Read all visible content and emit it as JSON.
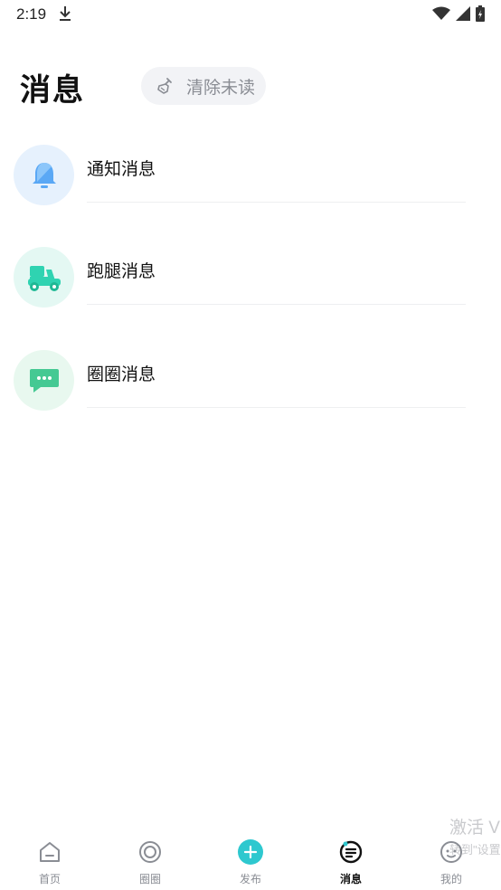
{
  "status_bar": {
    "time": "2:19"
  },
  "header": {
    "title": "消息",
    "clear_button": "清除未读"
  },
  "messages": [
    {
      "name": "通知消息",
      "icon": "bell-icon",
      "color": "#5aa8f5",
      "bg": "#e6f1fd"
    },
    {
      "name": "跑腿消息",
      "icon": "scooter-icon",
      "color": "#2fd3b1",
      "bg": "#e4f8f3"
    },
    {
      "name": "圈圈消息",
      "icon": "chat-bubble-icon",
      "color": "#45c993",
      "bg": "#e8f8ef"
    }
  ],
  "tabs": [
    {
      "label": "首页",
      "icon": "home-icon"
    },
    {
      "label": "圈圈",
      "icon": "circle-icon"
    },
    {
      "label": "发布",
      "icon": "plus-icon"
    },
    {
      "label": "消息",
      "icon": "message-icon",
      "active": true
    },
    {
      "label": "我的",
      "icon": "profile-icon"
    }
  ],
  "watermark": {
    "line1": "激活 V",
    "line2": "转到\"设置"
  },
  "colors": {
    "accent": "#2ec8cf",
    "text": "#111111",
    "muted": "#8a8d94"
  }
}
